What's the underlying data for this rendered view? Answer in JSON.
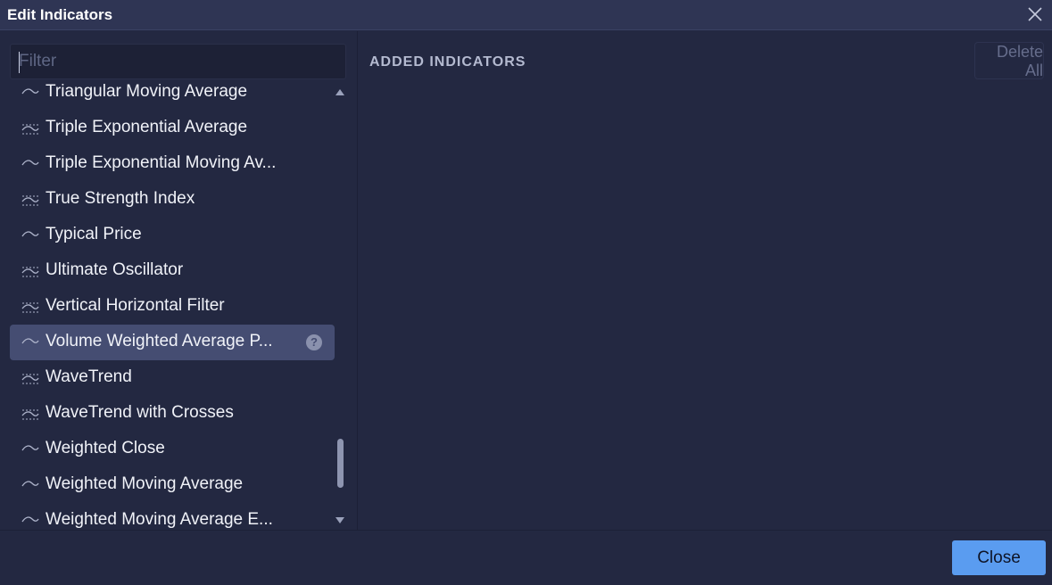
{
  "dialog": {
    "title": "Edit Indicators"
  },
  "filter": {
    "placeholder": "Filter",
    "value": ""
  },
  "indicators": [
    {
      "label": "Triangular Moving Average",
      "icon": "overlay-line-icon"
    },
    {
      "label": "Triple Exponential Average",
      "icon": "oscillator-icon"
    },
    {
      "label": "Triple Exponential Moving Av...",
      "icon": "overlay-line-icon"
    },
    {
      "label": "True Strength Index",
      "icon": "oscillator-icon"
    },
    {
      "label": "Typical Price",
      "icon": "overlay-line-icon"
    },
    {
      "label": "Ultimate Oscillator",
      "icon": "oscillator-icon"
    },
    {
      "label": "Vertical Horizontal Filter",
      "icon": "oscillator-icon"
    },
    {
      "label": "Volume Weighted Average P...",
      "icon": "overlay-line-icon",
      "selected": true,
      "help": "?"
    },
    {
      "label": "WaveTrend",
      "icon": "oscillator-icon"
    },
    {
      "label": "WaveTrend with Crosses",
      "icon": "oscillator-icon"
    },
    {
      "label": "Weighted Close",
      "icon": "overlay-line-icon"
    },
    {
      "label": "Weighted Moving Average",
      "icon": "overlay-line-icon"
    },
    {
      "label": "Weighted Moving Average E...",
      "icon": "overlay-line-icon"
    }
  ],
  "added": {
    "title": "ADDED INDICATORS",
    "delete_all_label": "Delete All"
  },
  "footer": {
    "close_label": "Close"
  },
  "colors": {
    "accent": "#5a9cf0",
    "background": "#232841",
    "selected": "#454d72"
  }
}
